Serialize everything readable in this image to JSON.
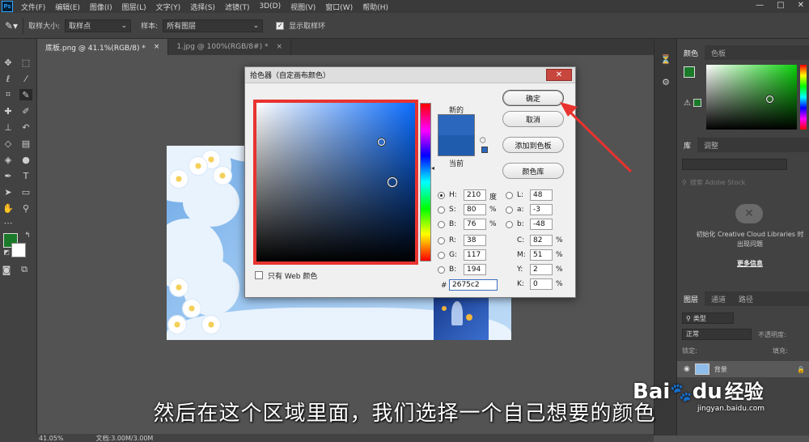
{
  "app": {
    "logo_text": "Ps"
  },
  "menu": [
    "文件(F)",
    "编辑(E)",
    "图像(I)",
    "图层(L)",
    "文字(Y)",
    "选择(S)",
    "滤镜(T)",
    "3D(D)",
    "视图(V)",
    "窗口(W)",
    "帮助(H)"
  ],
  "window_controls": {
    "min": "—",
    "max": "□",
    "close": "✕"
  },
  "options": {
    "sample_size_label": "取样大小:",
    "sample_size_value": "取样点",
    "sample_label": "样本:",
    "sample_value": "所有图层",
    "show_ring_label": "显示取样环",
    "show_ring_checked": "✓"
  },
  "tabs": [
    {
      "label": "底板.png @ 41.1%(RGB/8) *",
      "close": "×"
    },
    {
      "label": "1.jpg @ 100%(RGB/8#) *",
      "close": "×"
    }
  ],
  "colors": {
    "foreground": "#1a7a2a",
    "background": "#ffffff",
    "picked": "#2675c2"
  },
  "right_panel": {
    "color_tabs": [
      "颜色",
      "色板"
    ],
    "library_tabs": [
      "库",
      "调整"
    ],
    "library_search_placeholder": "搜索 Adobe Stock",
    "library_message": "初始化 Creative Cloud Libraries 时出现问题",
    "more_info": "更多信息",
    "layer_tabs": [
      "图层",
      "通道",
      "路径"
    ],
    "kind_filter": "类型",
    "blend_mode": "正常",
    "opacity_label": "不透明度:",
    "lock_label": "锁定:",
    "fill_label": "填充:",
    "layer_name": "背景"
  },
  "dialog": {
    "title": "拾色器（自定画布颜色）",
    "close": "✕",
    "ok": "确定",
    "cancel": "取消",
    "add_to_swatches": "添加到色板",
    "color_libraries": "颜色库",
    "new_label": "新的",
    "current_label": "当前",
    "web_only_label": "只有 Web 颜色",
    "hsb": [
      {
        "label": "H:",
        "value": "210",
        "unit": "度"
      },
      {
        "label": "S:",
        "value": "80",
        "unit": "%"
      },
      {
        "label": "B:",
        "value": "76",
        "unit": "%"
      }
    ],
    "rgb": [
      {
        "label": "R:",
        "value": "38"
      },
      {
        "label": "G:",
        "value": "117"
      },
      {
        "label": "B:",
        "value": "194"
      }
    ],
    "lab": [
      {
        "label": "L:",
        "value": "48"
      },
      {
        "label": "a:",
        "value": "-3"
      },
      {
        "label": "b:",
        "value": "-48"
      }
    ],
    "cmyk": [
      {
        "label": "C:",
        "value": "82",
        "unit": "%"
      },
      {
        "label": "M:",
        "value": "51",
        "unit": "%"
      },
      {
        "label": "Y:",
        "value": "2",
        "unit": "%"
      },
      {
        "label": "K:",
        "value": "0",
        "unit": "%"
      }
    ],
    "hex_label": "#",
    "hex_value": "2675c2"
  },
  "status": {
    "zoom": "41.05%",
    "doc": "文档:3.00M/3.00M"
  },
  "subtitle": "然后在这个区域里面，我们选择一个自己想要的颜色",
  "watermark": {
    "brand": "Bai",
    "paw": "du",
    "name": "经验",
    "url": "jingyan.baidu.com"
  }
}
